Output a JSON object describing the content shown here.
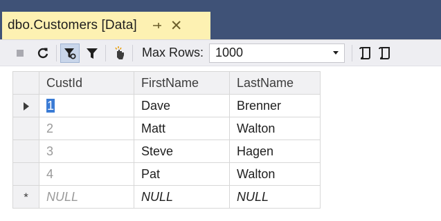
{
  "tab": {
    "title": "dbo.Customers [Data]",
    "pin_glyph": "⊣",
    "close_glyph": "✕"
  },
  "toolbar": {
    "max_rows_label": "Max Rows:",
    "max_rows_value": "1000",
    "icons": [
      "stop-icon",
      "refresh-icon",
      "filter-active-icon",
      "filter-icon",
      "hand-pointer-icon",
      "script-icon",
      "script-execute-icon"
    ],
    "accent_color": "#c9d6ea"
  },
  "grid": {
    "columns": [
      "CustId",
      "FirstName",
      "LastName"
    ],
    "rows": [
      {
        "CustId": "1",
        "FirstName": "Dave",
        "LastName": "Brenner"
      },
      {
        "CustId": "2",
        "FirstName": "Matt",
        "LastName": "Walton"
      },
      {
        "CustId": "3",
        "FirstName": "Steve",
        "LastName": "Hagen"
      },
      {
        "CustId": "4",
        "FirstName": "Pat",
        "LastName": "Walton"
      }
    ],
    "new_row": {
      "CustId": "NULL",
      "FirstName": "NULL",
      "LastName": "NULL",
      "marker": "*"
    }
  }
}
